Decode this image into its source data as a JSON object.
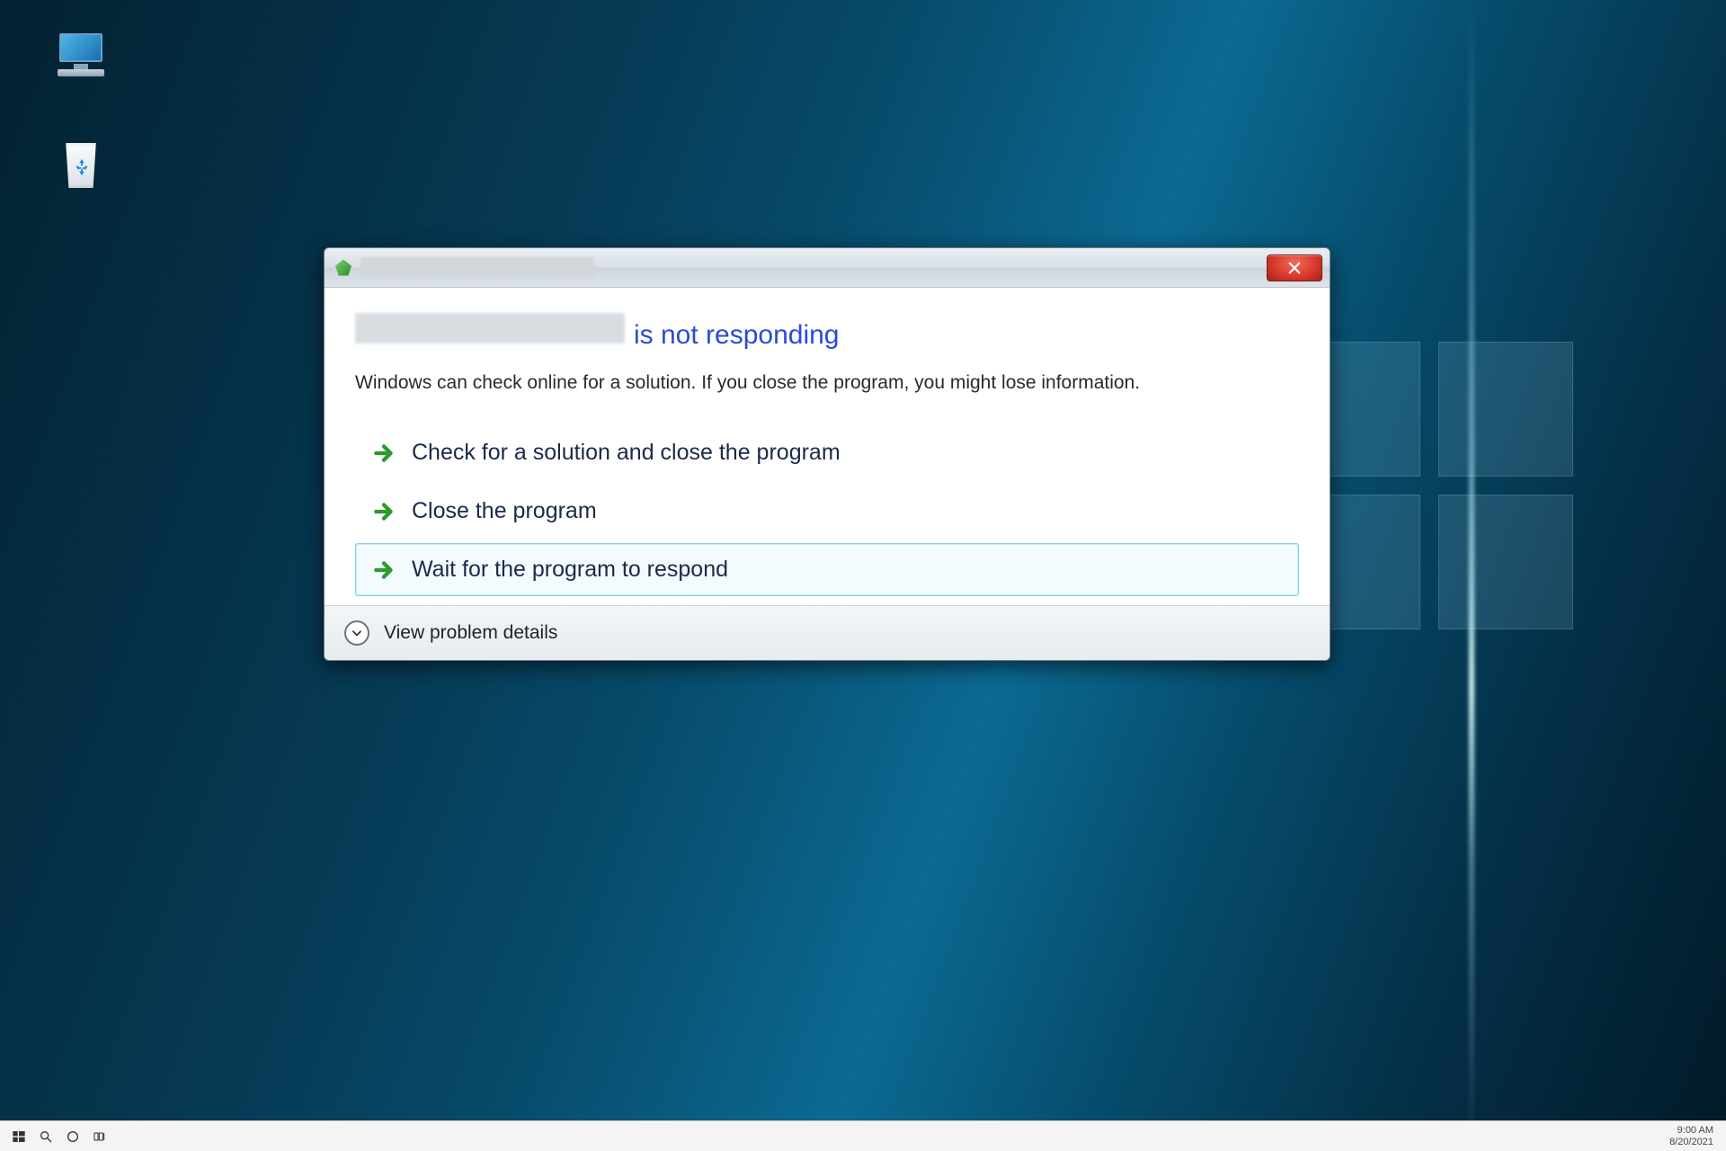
{
  "desktop": {
    "icons": {
      "this_pc": "",
      "recycle_bin": ""
    }
  },
  "dialog": {
    "title_redacted": "",
    "heading_app_redacted": "",
    "heading_suffix": "is not responding",
    "description": "Windows can check online for a solution. If you close the program, you might lose information.",
    "options": [
      "Check for a solution and close the program",
      "Close the program",
      "Wait for the program to respond"
    ],
    "details_label": "View problem details"
  },
  "taskbar": {
    "time": "9:00 AM",
    "date": "8/20/2021"
  }
}
